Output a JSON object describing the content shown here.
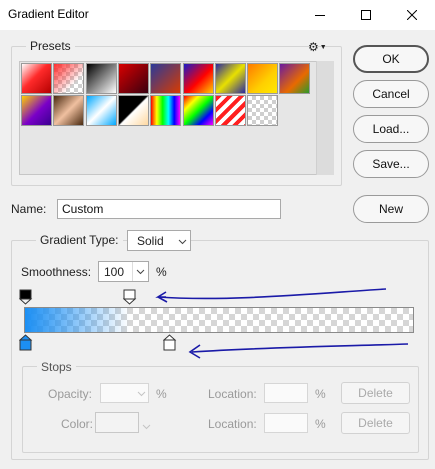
{
  "window": {
    "title": "Gradient Editor"
  },
  "presets": {
    "legend": "Presets",
    "gear_glyph": "⚙",
    "swatches": [
      "linear-gradient(135deg,#ffffff 0%,#ff2a2a 45%,#b40000 100%)",
      "linear-gradient(135deg,#ff2d2d 0%,rgba(255,45,45,0) 70%), repeating-conic-gradient(#cfcfcf 0% 25%,#fff 0% 50%) 0 0/8px 8px",
      "linear-gradient(135deg,#000000 0%,#ffffff 100%)",
      "linear-gradient(135deg,#d80000 0%,#3a0010 100%)",
      "linear-gradient(135deg,#2a3a9a 0%,#d83a00 100%)",
      "linear-gradient(135deg,#1a1ac8 0%,#ff0000 55%,#ffd000 100%)",
      "linear-gradient(135deg,#2a2aa0 0%,#e8e000 50%,#2a2aa0 100%)",
      "linear-gradient(135deg,#ff7a00 0%,#ffd000 60%,#ffe800 100%)",
      "linear-gradient(135deg,#6a1aa0 0%,#e86a00 60%,#2a9a2a 100%)",
      "linear-gradient(135deg,#ffd000 0%,#7a00c8 55%,#3a0090 100%)",
      "linear-gradient(135deg,#4a2a10 0%,#f0c0a0 50%,#4a2a10 100%)",
      "linear-gradient(135deg,#00a8ff 0%,#ffffff 50%,#00a8ff 100%)",
      "linear-gradient(135deg,#000000 0%,#000000 48%,#ffffff 52%,#ffd8a0 100%)",
      "linear-gradient(90deg,#ff0000,#ffff00,#00ff00,#00ffff,#0000ff,#ff00ff)",
      "linear-gradient(135deg,#ff0000,#ffff00,#00ff00,#0000ff,#ff00ff), repeating-conic-gradient(#cfcfcf 0% 25%,#fff 0% 50%) 0 0/8px 8px",
      "repeating-linear-gradient(135deg,#ff2020 0 4px,#ffffff 4px 8px)",
      "repeating-conic-gradient(#cfcfcf 0% 25%,#fff 0% 50%) 0 0/8px 8px"
    ]
  },
  "buttons": {
    "ok": "OK",
    "cancel": "Cancel",
    "load": "Load...",
    "save": "Save...",
    "new": "New"
  },
  "name": {
    "label": "Name:",
    "value": "Custom"
  },
  "gradient": {
    "type_label": "Gradient Type:",
    "type_value": "Solid",
    "smoothness_label": "Smoothness:",
    "smoothness_value": "100",
    "percent": "%",
    "start_color": "#1c8ff3",
    "fade_end_percent": 27,
    "opacity_stop_left_percent": 0,
    "opacity_stop_mid_percent": 27,
    "color_stop_left_percent": 0,
    "color_stop_mid_percent": 37
  },
  "stops": {
    "legend": "Stops",
    "opacity_label": "Opacity:",
    "opacity_unit": "%",
    "color_label": "Color:",
    "location_label": "Location:",
    "location_unit": "%",
    "delete_label": "Delete"
  },
  "annotation": {
    "arrow_color": "#1a1aa8"
  }
}
